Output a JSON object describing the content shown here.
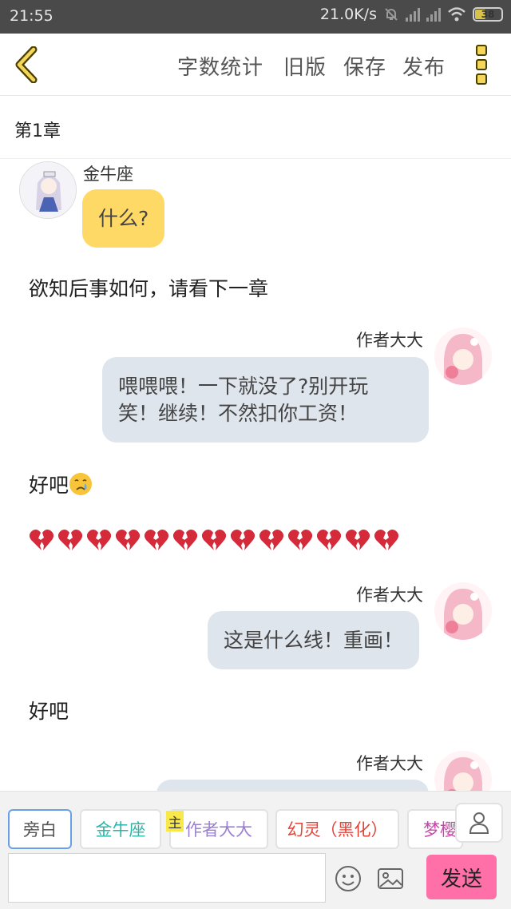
{
  "status": {
    "time": "21:55",
    "net_speed": "21.0K/s",
    "battery": "38"
  },
  "toolbar": {
    "word_count": "字数统计",
    "old_version": "旧版",
    "save": "保存",
    "publish": "发布"
  },
  "chapter": {
    "title": "第1章"
  },
  "messages": [
    {
      "speaker": "金牛座",
      "text": "什么?"
    },
    {
      "narration": "欲知后事如何，请看下一章"
    },
    {
      "speaker": "作者大大",
      "text_line1": "喂喂喂！一下就没了?别开玩",
      "text_line2": "笑！继续！不然扣你工资！"
    },
    {
      "narration": "好吧"
    },
    {
      "narration_hearts": 13
    },
    {
      "speaker": "作者大大",
      "text": "这是什么线！重画！"
    },
    {
      "narration": "好吧"
    },
    {
      "speaker": "作者大大"
    }
  ],
  "roles": [
    {
      "label": "旁白",
      "color": "#555555"
    },
    {
      "label": "金牛座",
      "color": "#2bb6a8"
    },
    {
      "label": "作者大大",
      "color": "#9b7fd4"
    },
    {
      "label": "幻灵（黑化）",
      "color": "#e0453a"
    },
    {
      "label": "梦樱",
      "color": "#cc44aa"
    }
  ],
  "host_badge": "主",
  "composer": {
    "placeholder": "",
    "send": "发送"
  },
  "colors": {
    "accent_yellow": "#f3d65a",
    "bubble_yellow": "#ffd966",
    "bubble_grey": "#dfe5ec",
    "send_pink": "#ff6fa8"
  }
}
